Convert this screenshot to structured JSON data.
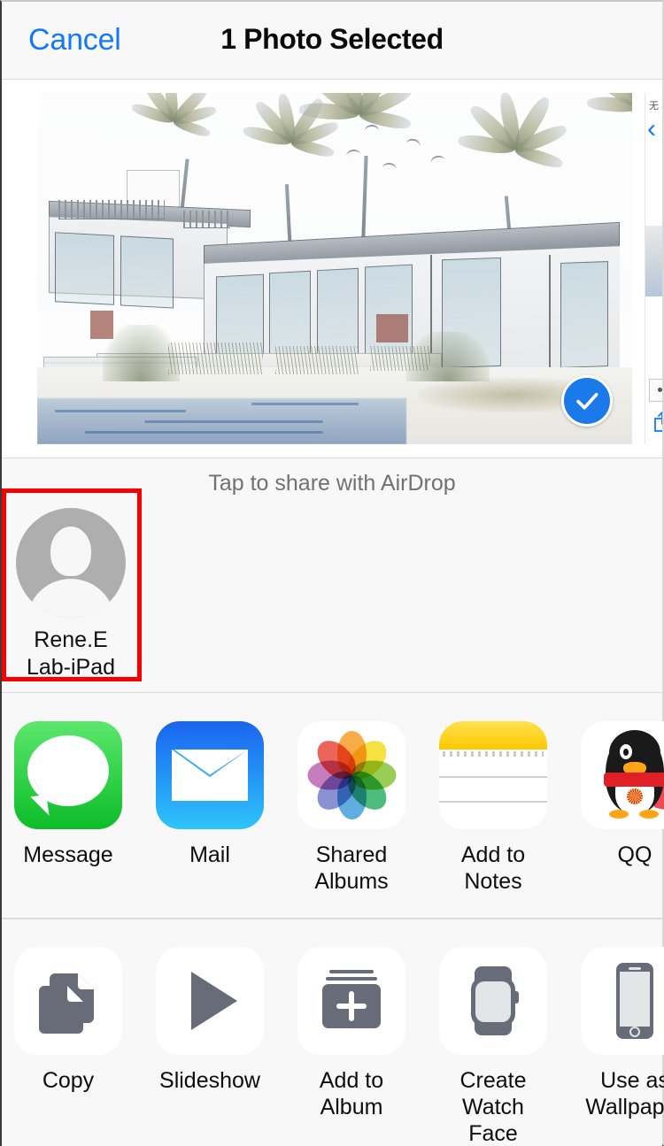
{
  "header": {
    "cancel_label": "Cancel",
    "title": "1 Photo Selected",
    "cancel_color": "#1379fb"
  },
  "preview": {
    "selected_badge_icon": "checkmark-circle-icon",
    "badge_color": "#1b7aea",
    "photo_description": "Pencil sketch rendering of a modernist beach house with palm trees",
    "next_card": {
      "status_text": "无 SI",
      "back_icon": "chevron-left-icon",
      "share_icon": "share-icon"
    }
  },
  "airdrop": {
    "hint": "Tap to share with AirDrop",
    "contacts": [
      {
        "name_line1": "Rene.E",
        "name_line2": "Lab-iPad",
        "avatar_icon": "person-silhouette-icon",
        "highlighted": true
      }
    ],
    "highlight_color": "#f90000"
  },
  "apps": {
    "items": [
      {
        "label": "Message",
        "icon": "messages-app-icon",
        "color": "#0cbd29"
      },
      {
        "label": "Mail",
        "icon": "mail-app-icon",
        "color": "#1a64ee"
      },
      {
        "label": "Shared\nAlbums",
        "icon": "photos-app-icon",
        "color": "#ffffff"
      },
      {
        "label": "Add to Notes",
        "icon": "notes-app-icon",
        "color": "#fcc800"
      },
      {
        "label": "QQ",
        "icon": "qq-app-icon",
        "color": "#e01f26"
      }
    ]
  },
  "actions": {
    "items": [
      {
        "label": "Copy",
        "icon": "copy-documents-icon"
      },
      {
        "label": "Slideshow",
        "icon": "play-triangle-icon"
      },
      {
        "label": "Add to Album",
        "icon": "add-to-album-icon"
      },
      {
        "label": "Create\nWatch Face",
        "icon": "apple-watch-icon"
      },
      {
        "label": "Use as\nWallpaper",
        "icon": "iphone-icon"
      }
    ],
    "icon_color": "#686b78"
  }
}
